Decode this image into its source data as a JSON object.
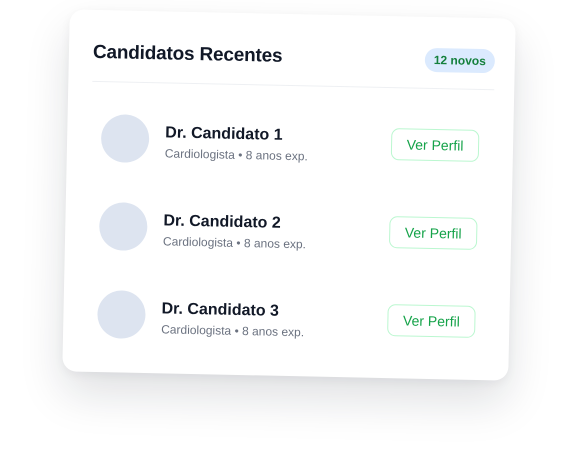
{
  "card": {
    "title": "Candidatos Recentes",
    "badge": "12 novos"
  },
  "candidates": [
    {
      "name": "Dr. Candidato 1",
      "specialty": "Cardiologista",
      "separator": "•",
      "experience": "8 anos exp.",
      "action": "Ver Perfil"
    },
    {
      "name": "Dr. Candidato 2",
      "specialty": "Cardiologista",
      "separator": "•",
      "experience": "8 anos exp.",
      "action": "Ver Perfil"
    },
    {
      "name": "Dr. Candidato 3",
      "specialty": "Cardiologista",
      "separator": "•",
      "experience": "8 anos exp.",
      "action": "Ver Perfil"
    }
  ],
  "colors": {
    "accent_green": "#16a34a",
    "badge_background": "#dbeafe",
    "avatar_placeholder": "#dde4f0"
  }
}
